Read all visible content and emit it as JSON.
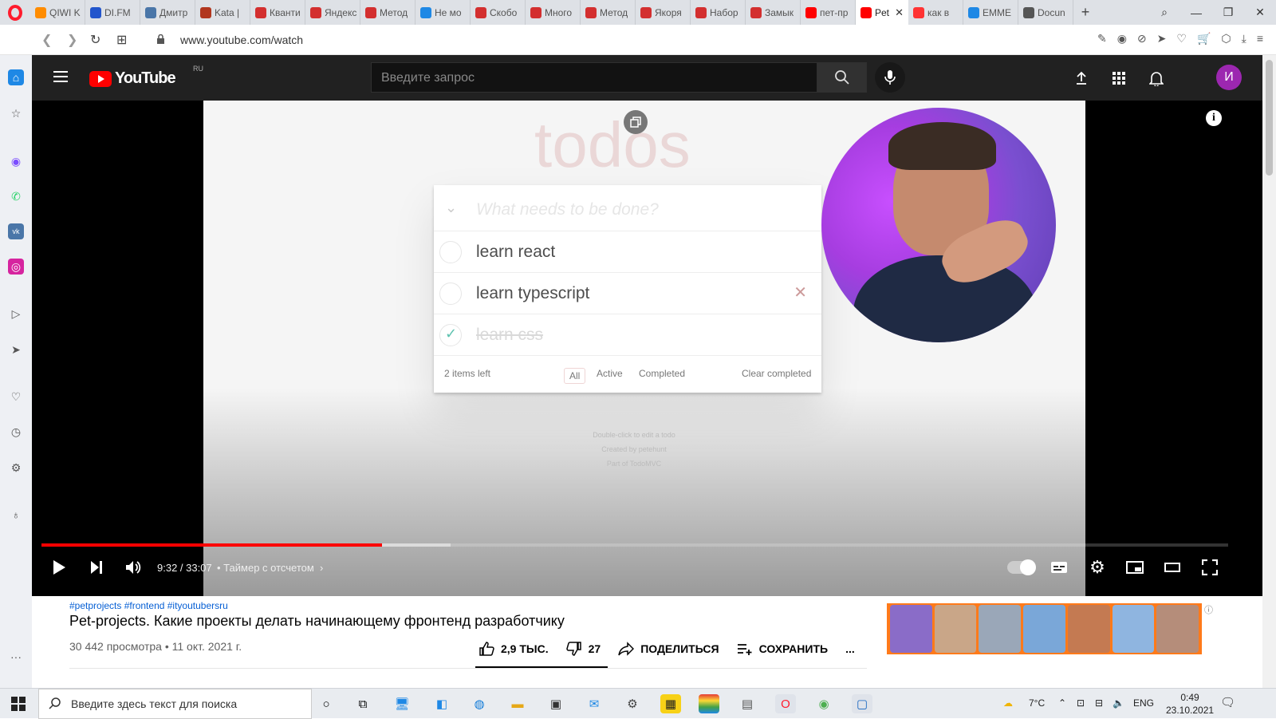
{
  "browser": {
    "tabs": [
      {
        "label": "QIWI K",
        "color": "#ff8c00"
      },
      {
        "label": "DI.FM",
        "color": "#2255cc"
      },
      {
        "label": "Дмитр",
        "color": "#4a76a8"
      },
      {
        "label": "Kata |",
        "color": "#b1361e"
      },
      {
        "label": "Кванти",
        "color": "#d32f2f"
      },
      {
        "label": "Яндекс",
        "color": "#d32f2f"
      },
      {
        "label": "Метод",
        "color": "#d32f2f"
      },
      {
        "label": "Не мо",
        "color": "#1e88e5"
      },
      {
        "label": "Скобо",
        "color": "#d32f2f"
      },
      {
        "label": "Много",
        "color": "#d32f2f"
      },
      {
        "label": "Метод",
        "color": "#d32f2f"
      },
      {
        "label": "Якоря",
        "color": "#d32f2f"
      },
      {
        "label": "Набор",
        "color": "#d32f2f"
      },
      {
        "label": "Замык",
        "color": "#d32f2f"
      },
      {
        "label": "пет-пр",
        "color": "#ff0000"
      },
      {
        "label": "Pet",
        "color": "#ff0000",
        "active": true
      },
      {
        "label": "как в",
        "color": "#ff3333"
      },
      {
        "label": "EMME",
        "color": "#1e88e5"
      },
      {
        "label": "Docun",
        "color": "#555555"
      }
    ],
    "url": "www.youtube.com/watch"
  },
  "youtube": {
    "logo_text": "YouTube",
    "logo_region": "RU",
    "search_placeholder": "Введите запрос",
    "avatar_letter": "И"
  },
  "video": {
    "todo": {
      "title": "todos",
      "input_placeholder": "What needs to be done?",
      "items": [
        {
          "text": "learn react",
          "done": false
        },
        {
          "text": "learn typescript",
          "done": false
        },
        {
          "text": "learn css",
          "done": true
        }
      ],
      "items_left": "2 items left",
      "filters": [
        "All",
        "Active",
        "Completed"
      ],
      "clear": "Clear completed",
      "info": [
        "Double-click to edit a todo",
        "Created by petehunt",
        "Part of TodoMVC"
      ]
    },
    "info_button": "i",
    "current_time": "9:32",
    "duration": "33:07",
    "chapter": "Таймер с отсчетом",
    "progress": 0.287,
    "buffered": 0.345
  },
  "watch": {
    "tags": "#petprojects #frontend #ityoutubersru",
    "title": "Pet-projects. Какие проекты делать начинающему фронтенд разработчику",
    "meta": "30 442 просмотра • 11 окт. 2021 г.",
    "likes": "2,9 ТЫС.",
    "dislikes": "27",
    "share": "ПОДЕЛИТЬСЯ",
    "save": "СОХРАНИТЬ",
    "more": "..."
  },
  "taskbar": {
    "search_placeholder": "Введите здесь текст для поиска",
    "temperature": "7°C",
    "language": "ENG",
    "time": "0:49",
    "date": "23.10.2021"
  }
}
